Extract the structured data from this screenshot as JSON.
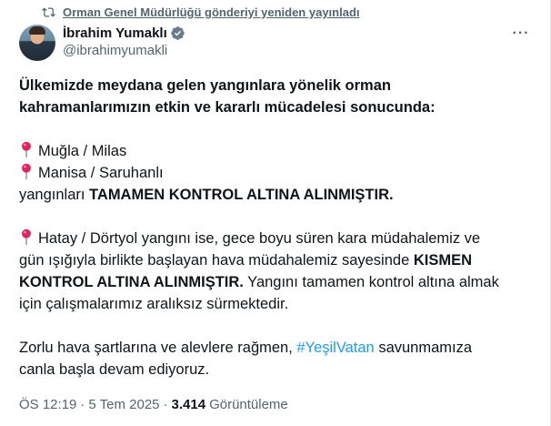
{
  "repost": {
    "text": "Orman Genel Müdürlüğü gönderiyi yeniden yayınladı",
    "icon": "repost-icon"
  },
  "author": {
    "display_name": "İbrahim Yumaklı",
    "handle": "@ibrahimyumakli",
    "verified_icon": "verified-badge-icon"
  },
  "more_label": "···",
  "body": {
    "intro_line1": "Ülkemizde meydana gelen yangınlara yönelik orman",
    "intro_line2": "kahramanlarımızın etkin ve kararlı mücadelesi sonucunda:",
    "loc1": "Muğla / Milas",
    "loc2": "Manisa / Saruhanlı",
    "fires_prefix": "yangınları ",
    "fires_bold": "TAMAMEN KONTROL ALTINA ALINMIŞTIR.",
    "hatay_text1": "Hatay / Dörtyol yangını ise, gece boyu süren kara müdahalemiz ve",
    "hatay_text2": "gün ışığıyla birlikte başlayan hava müdahalemiz sayesinde ",
    "hatay_bold1": "KISMEN",
    "hatay_bold2": "KONTROL ALTINA ALINMIŞTIR.",
    "hatay_text3": " Yangını tamamen kontrol altına almak",
    "hatay_text4": "için çalışmalarımız aralıksız sürmektedir.",
    "closing1_prefix": "Zorlu hava şartlarına ve alevlere rağmen, ",
    "hashtag": "#YeşilVatan",
    "closing1_suffix": " savunmamıza",
    "closing2": "canla başla devam ediyoruz."
  },
  "meta": {
    "time": "ÖS 12:19",
    "separator": "·",
    "date": "5 Tem 2025",
    "views_count": "3.414",
    "views_label": "Görüntüleme"
  },
  "colors": {
    "text": "#0f1419",
    "muted": "#536471",
    "accent": "#1d9bf0",
    "pin": "#e0245e"
  }
}
